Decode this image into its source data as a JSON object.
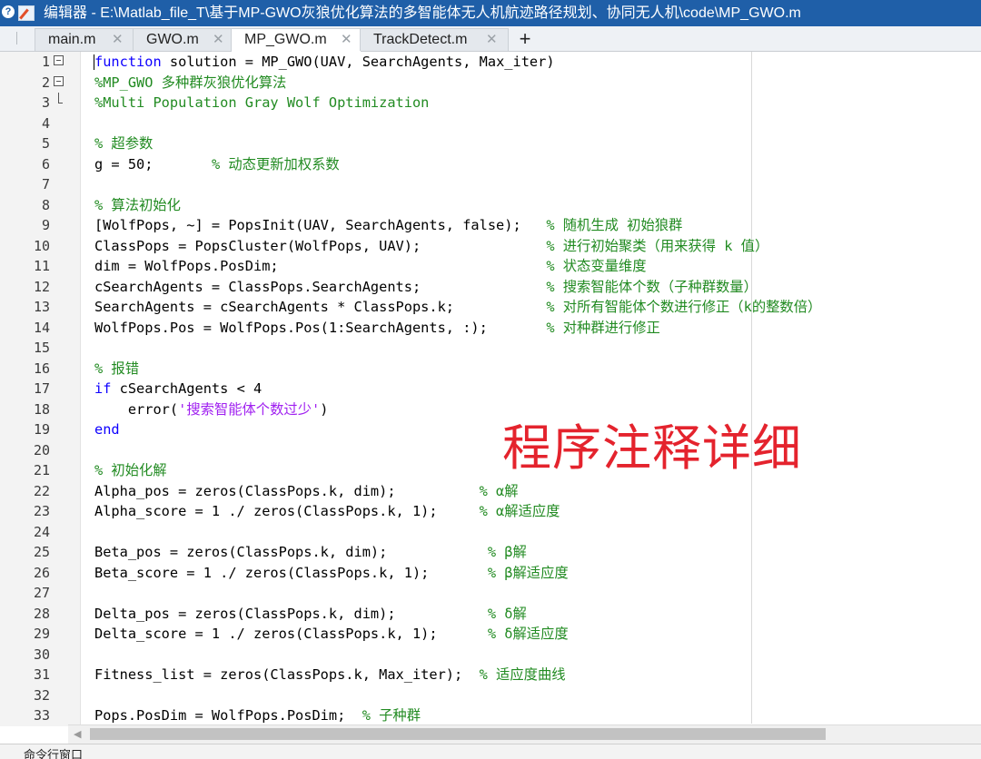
{
  "window": {
    "title": "编辑器 - E:\\Matlab_file_T\\基于MP-GWO灰狼优化算法的多智能体无人机航迹路径规划、协同无人机\\code\\MP_GWO.m"
  },
  "tabs": [
    {
      "label": "main.m",
      "active": false
    },
    {
      "label": "GWO.m",
      "active": false
    },
    {
      "label": "MP_GWO.m",
      "active": true
    },
    {
      "label": "TrackDetect.m",
      "active": false
    }
  ],
  "tab_close_glyph": "✕",
  "tab_add_glyph": "+",
  "code_lines": [
    {
      "n": "1",
      "parts": [
        [
          "kw",
          "function"
        ],
        [
          "",
          " solution = MP_GWO(UAV, SearchAgents, Max_iter)"
        ]
      ]
    },
    {
      "n": "2",
      "parts": [
        [
          "cm",
          "%MP_GWO 多种群灰狼优化算法"
        ]
      ]
    },
    {
      "n": "3",
      "parts": [
        [
          "cm",
          "%Multi Population Gray Wolf Optimization"
        ]
      ]
    },
    {
      "n": "4",
      "parts": []
    },
    {
      "n": "5",
      "parts": [
        [
          "cm",
          "% 超参数"
        ]
      ]
    },
    {
      "n": "6",
      "parts": [
        [
          "",
          "g = 50;       "
        ],
        [
          "cm",
          "% 动态更新加权系数"
        ]
      ]
    },
    {
      "n": "7",
      "parts": []
    },
    {
      "n": "8",
      "parts": [
        [
          "cm",
          "% 算法初始化"
        ]
      ]
    },
    {
      "n": "9",
      "parts": [
        [
          "",
          "[WolfPops, ~] = PopsInit(UAV, SearchAgents, false);   "
        ],
        [
          "cm",
          "% 随机生成 初始狼群"
        ]
      ]
    },
    {
      "n": "10",
      "parts": [
        [
          "",
          "ClassPops = PopsCluster(WolfPops, UAV);               "
        ],
        [
          "cm",
          "% 进行初始聚类（用来获得 k 值）"
        ]
      ]
    },
    {
      "n": "11",
      "parts": [
        [
          "",
          "dim = WolfPops.PosDim;                                "
        ],
        [
          "cm",
          "% 状态变量维度"
        ]
      ]
    },
    {
      "n": "12",
      "parts": [
        [
          "",
          "cSearchAgents = ClassPops.SearchAgents;               "
        ],
        [
          "cm",
          "% 搜索智能体个数（子种群数量）"
        ]
      ]
    },
    {
      "n": "13",
      "parts": [
        [
          "",
          "SearchAgents = cSearchAgents * ClassPops.k;           "
        ],
        [
          "cm",
          "% 对所有智能体个数进行修正（k的整数倍）"
        ]
      ]
    },
    {
      "n": "14",
      "parts": [
        [
          "",
          "WolfPops.Pos = WolfPops.Pos(1:SearchAgents, :);       "
        ],
        [
          "cm",
          "% 对种群进行修正"
        ]
      ]
    },
    {
      "n": "15",
      "parts": []
    },
    {
      "n": "16",
      "parts": [
        [
          "cm",
          "% 报错"
        ]
      ]
    },
    {
      "n": "17",
      "parts": [
        [
          "kw",
          "if"
        ],
        [
          "",
          " cSearchAgents < 4"
        ]
      ]
    },
    {
      "n": "18",
      "parts": [
        [
          "",
          "    error("
        ],
        [
          "str",
          "'搜索智能体个数过少'"
        ],
        [
          "",
          ")"
        ]
      ]
    },
    {
      "n": "19",
      "parts": [
        [
          "kw",
          "end"
        ]
      ]
    },
    {
      "n": "20",
      "parts": []
    },
    {
      "n": "21",
      "parts": [
        [
          "cm",
          "% 初始化解"
        ]
      ]
    },
    {
      "n": "22",
      "parts": [
        [
          "",
          "Alpha_pos = zeros(ClassPops.k, dim);          "
        ],
        [
          "cm",
          "% α解"
        ]
      ]
    },
    {
      "n": "23",
      "parts": [
        [
          "",
          "Alpha_score = 1 ./ zeros(ClassPops.k, 1);     "
        ],
        [
          "cm",
          "% α解适应度"
        ]
      ]
    },
    {
      "n": "24",
      "parts": []
    },
    {
      "n": "25",
      "parts": [
        [
          "",
          "Beta_pos = zeros(ClassPops.k, dim);            "
        ],
        [
          "cm",
          "% β解"
        ]
      ]
    },
    {
      "n": "26",
      "parts": [
        [
          "",
          "Beta_score = 1 ./ zeros(ClassPops.k, 1);       "
        ],
        [
          "cm",
          "% β解适应度"
        ]
      ]
    },
    {
      "n": "27",
      "parts": []
    },
    {
      "n": "28",
      "parts": [
        [
          "",
          "Delta_pos = zeros(ClassPops.k, dim);           "
        ],
        [
          "cm",
          "% δ解"
        ]
      ]
    },
    {
      "n": "29",
      "parts": [
        [
          "",
          "Delta_score = 1 ./ zeros(ClassPops.k, 1);      "
        ],
        [
          "cm",
          "% δ解适应度"
        ]
      ]
    },
    {
      "n": "30",
      "parts": []
    },
    {
      "n": "31",
      "parts": [
        [
          "",
          "Fitness_list = zeros(ClassPops.k, Max_iter);  "
        ],
        [
          "cm",
          "% 适应度曲线"
        ]
      ]
    },
    {
      "n": "32",
      "parts": []
    },
    {
      "n": "33",
      "parts": [
        [
          "",
          "Pops.PosDim = WolfPops.PosDim;  "
        ],
        [
          "cm",
          "% 子种群"
        ]
      ]
    }
  ],
  "overlay_caption": "程序注释详细",
  "bottom_panel_title": "命令行窗口",
  "colors": {
    "keyword": "#0e00ff",
    "comment": "#228b22",
    "string": "#a020f0",
    "caption": "#e4232d",
    "titlebar": "#1f5fa8"
  },
  "icons": [
    "help-icon",
    "editor-icon",
    "close-icon",
    "add-icon",
    "fold-collapse-icon",
    "scroll-left-icon"
  ]
}
